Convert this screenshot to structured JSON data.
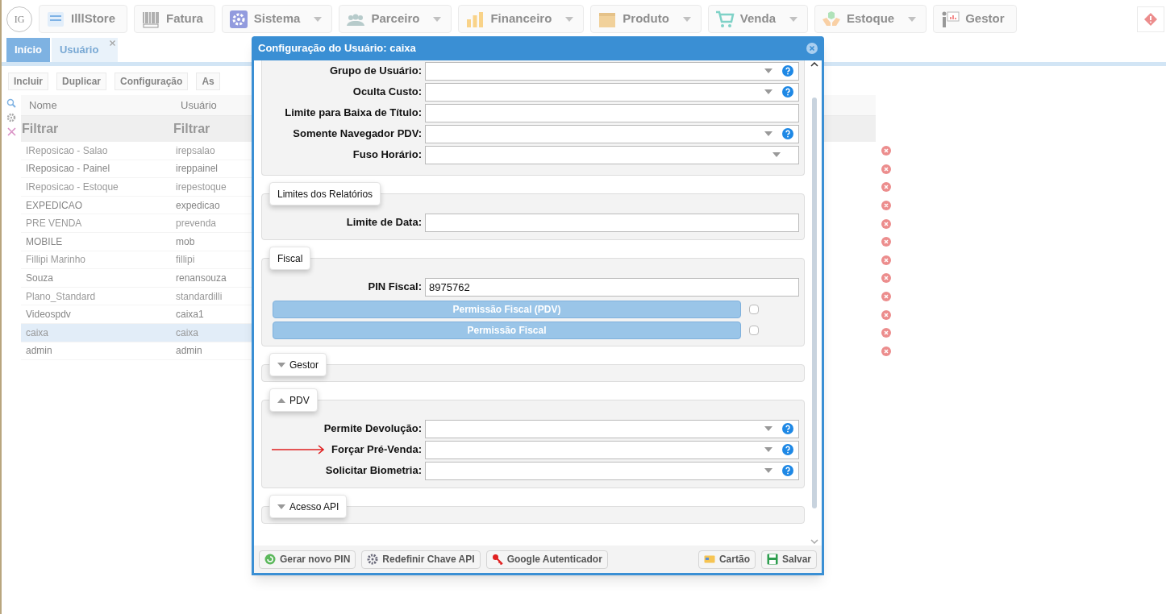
{
  "nav": {
    "logo": "IG",
    "items": [
      {
        "label": "IlllStore",
        "has_menu": false
      },
      {
        "label": "Fatura",
        "has_menu": false
      },
      {
        "label": "Sistema",
        "has_menu": true
      },
      {
        "label": "Parceiro",
        "has_menu": true
      },
      {
        "label": "Financeiro",
        "has_menu": true
      },
      {
        "label": "Produto",
        "has_menu": true
      },
      {
        "label": "Venda",
        "has_menu": true
      },
      {
        "label": "Estoque",
        "has_menu": true
      },
      {
        "label": "Gestor",
        "has_menu": false
      }
    ]
  },
  "tabs": [
    {
      "label": "Início",
      "selected": true,
      "closable": false
    },
    {
      "label": "Usuário",
      "selected": false,
      "closable": true
    }
  ],
  "toolbar": [
    "Incluir",
    "Duplicar",
    "Configuração",
    "As"
  ],
  "table": {
    "columns": [
      "Nome",
      "Usuário"
    ],
    "filters": [
      "Filtrar",
      "Filtrar"
    ],
    "rows": [
      {
        "name": "IReposicao - Salao",
        "user": "irepsalao",
        "selected": false
      },
      {
        "name": "IReposicao - Painel",
        "user": "ireppainel",
        "selected": false
      },
      {
        "name": "IReposicao - Estoque",
        "user": "irepestoque",
        "selected": false
      },
      {
        "name": "EXPEDICAO",
        "user": "expedicao",
        "selected": false
      },
      {
        "name": "PRE VENDA",
        "user": "prevenda",
        "selected": false
      },
      {
        "name": "MOBILE",
        "user": "mob",
        "selected": false
      },
      {
        "name": "Fillipi Marinho",
        "user": "fillipi",
        "selected": false
      },
      {
        "name": "Souza",
        "user": "renansouza",
        "selected": false
      },
      {
        "name": "Plano_Standard",
        "user": "standardilli",
        "selected": false
      },
      {
        "name": "Videospdv",
        "user": "caixa1",
        "selected": false
      },
      {
        "name": "caixa",
        "user": "caixa",
        "selected": true
      },
      {
        "name": "admin",
        "user": "admin",
        "selected": false
      }
    ]
  },
  "dialog": {
    "title": "Configuração do Usuário: caixa",
    "sections": [
      {
        "fields": [
          {
            "label": "Grupo de Usuário:",
            "kind": "select",
            "help": true,
            "marked": false
          },
          {
            "label": "Oculta Custo:",
            "kind": "select",
            "help": true,
            "marked": false
          },
          {
            "label": "Limite para Baixa de Título:",
            "kind": "text",
            "marked": false
          },
          {
            "label": "Somente Navegador PDV:",
            "kind": "select",
            "help": true,
            "marked": false
          },
          {
            "label": "Fuso Horário:",
            "kind": "select",
            "help": false,
            "marked": false
          }
        ]
      },
      {
        "legend": "Limites dos Relatórios",
        "fields": [
          {
            "label": "Limite de Data:",
            "kind": "text",
            "marked": false
          }
        ]
      },
      {
        "legend": "Fiscal",
        "fields": [
          {
            "label": "PIN Fiscal:",
            "kind": "text",
            "marked": false,
            "value": "8975762"
          }
        ],
        "permissions": [
          {
            "label": "Permissão Fiscal (PDV)",
            "checked": false
          },
          {
            "label": "Permissão Fiscal",
            "checked": false
          }
        ]
      },
      {
        "legend": "Gestor",
        "expanded": false
      },
      {
        "legend": "PDV",
        "expanded": true,
        "fields": [
          {
            "label": "Permite Devolução:",
            "kind": "select",
            "help": true,
            "marked": false
          },
          {
            "label": "Forçar Pré-Venda:",
            "kind": "select",
            "help": true,
            "marked": true
          },
          {
            "label": "Solicitar Biometria:",
            "kind": "select",
            "help": true,
            "marked": false
          }
        ]
      },
      {
        "legend": "Acesso API",
        "expanded": false
      }
    ],
    "footer_left": [
      "Gerar novo PIN",
      "Redefinir Chave API",
      "Google Autenticador"
    ],
    "footer_right": [
      "Cartão",
      "Salvar"
    ]
  }
}
